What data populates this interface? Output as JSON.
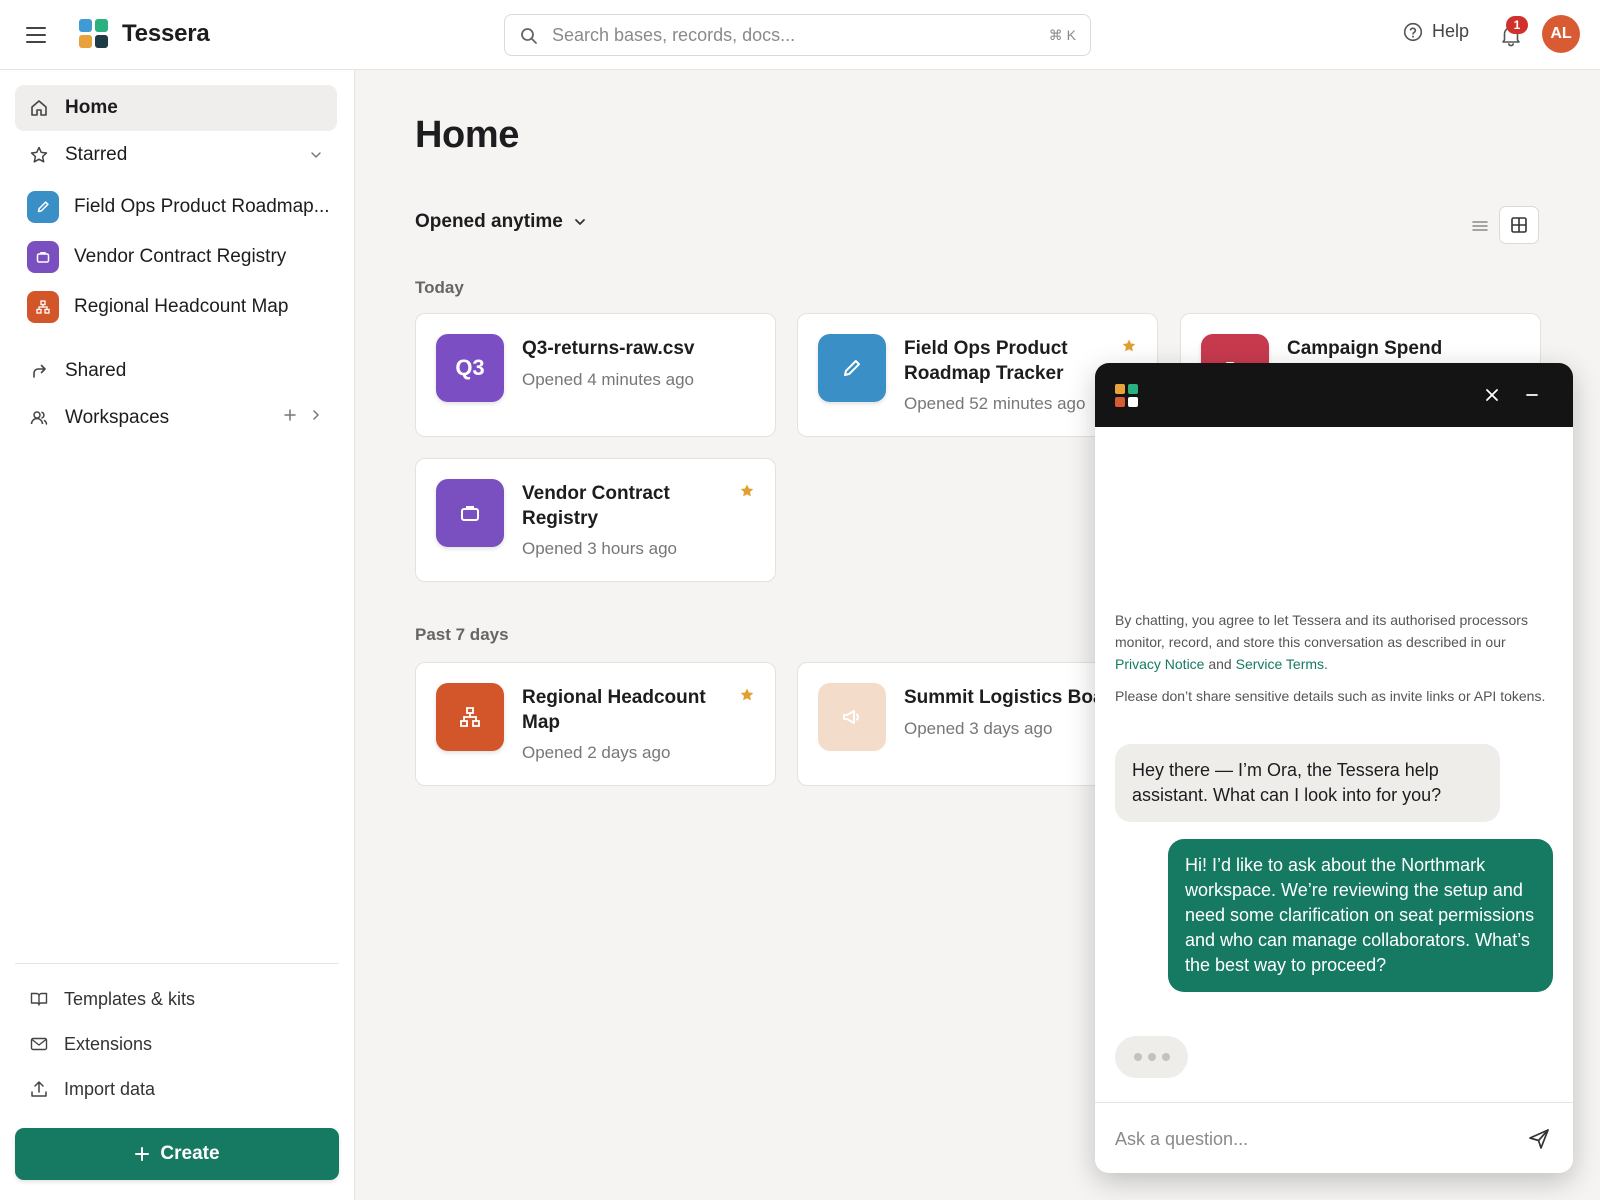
{
  "app": {
    "name": "Tessera",
    "logo_colors": [
      "#3f9ad6",
      "#2bb07f",
      "#e9a23b",
      "#1f3b45"
    ]
  },
  "search": {
    "placeholder": "Search bases, records, docs...",
    "shortcut": "⌘ K"
  },
  "header": {
    "help_label": "Help",
    "notification_count": "1",
    "avatar_initials": "AL"
  },
  "sidebar": {
    "home_label": "Home",
    "starred_label": "Starred",
    "starred_items": [
      {
        "label": "Field Ops Product Roadmap...",
        "color": "#3a8fc7",
        "icon": "pencil-icon"
      },
      {
        "label": "Vendor Contract Registry",
        "color": "#7a4fc0",
        "icon": "briefcase-icon"
      },
      {
        "label": "Regional Headcount Map",
        "color": "#d2562a",
        "icon": "org-chart-icon"
      }
    ],
    "shared_label": "Shared",
    "workspaces_label": "Workspaces",
    "footer": {
      "templates_label": "Templates & kits",
      "extensions_label": "Extensions",
      "import_label": "Import data"
    },
    "create_label": "Create"
  },
  "main": {
    "title": "Home",
    "filter_label": "Opened anytime",
    "sections": [
      {
        "label": "Today",
        "cards": [
          {
            "icon_text": "Q3",
            "title": "Q3-returns-raw.csv",
            "subtitle": "Opened 4 minutes ago",
            "color": "#7b4fc3",
            "starred": false
          },
          {
            "icon": "pencil-icon",
            "title": "Field Ops Product Roadmap Tracker",
            "subtitle": "Opened 52 minutes ago",
            "color": "#3a8fc7",
            "starred": true
          },
          {
            "icon": "folder-icon",
            "title": "Campaign Spend Ledger",
            "subtitle": "",
            "color": "#c73a4e",
            "starred": false
          },
          {
            "icon": "briefcase-icon",
            "title": "Vendor Contract Registry",
            "subtitle": "Opened 3 hours ago",
            "color": "#7a4fc0",
            "starred": true
          }
        ]
      },
      {
        "label": "Past 7 days",
        "cards": [
          {
            "icon": "org-chart-icon",
            "title": "Regional Headcount Map",
            "subtitle": "Opened 2 days ago",
            "color": "#d2562a",
            "starred": true
          },
          {
            "icon": "megaphone-icon",
            "title": "Summit Logistics Board",
            "subtitle": "Opened 3 days ago",
            "color": "#f4dccb",
            "starred": false
          }
        ]
      }
    ]
  },
  "chat": {
    "notice_prefix": "By chatting, you agree to let Tessera and its authorised processors monitor, record, and store this conversation as described in our ",
    "privacy_link": "Privacy Notice",
    "notice_and": " and ",
    "terms_link": "Service Terms",
    "notice_suffix": ".",
    "notice2": "Please don’t share sensitive details such as invite links or API tokens.",
    "bot_message": "Hey there — I’m Ora, the Tessera help assistant. What can I look into for you?",
    "user_message": "Hi! I’d like to ask about the Northmark workspace. We’re reviewing the setup and need some clarification on seat permissions and who can manage collaborators. What’s the best way to proceed?",
    "input_placeholder": "Ask a question..."
  },
  "colors": {
    "accent": "#167a62",
    "star": "#e0a02f"
  }
}
